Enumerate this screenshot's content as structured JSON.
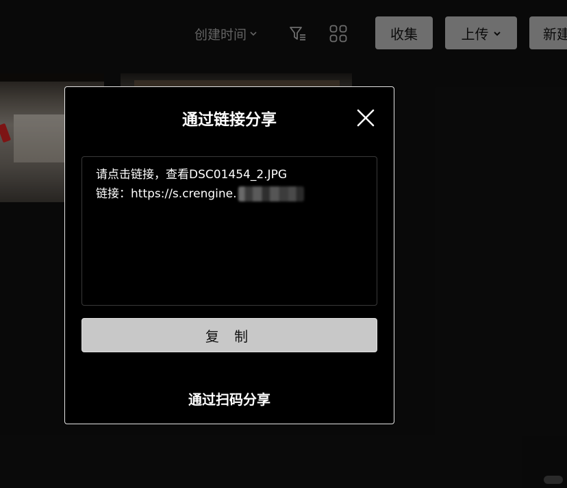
{
  "toolbar": {
    "sort_label": "创建时间",
    "sort_icon": "chevron-down-icon",
    "filter_icon": "filter-list-icon",
    "view_icon": "grid-view-icon",
    "collect_label": "收集",
    "upload_label": "上传",
    "upload_icon": "chevron-down-icon",
    "new_label": "新建"
  },
  "share_dialog": {
    "title": "通过链接分享",
    "close_icon": "close-icon",
    "message_line1": "请点击链接，查看DSC01454_2.JPG",
    "message_line2": "链接：https://s.crengine.",
    "copy_label": "复 制",
    "qr_share_label": "通过扫码分享"
  },
  "colors": {
    "page_background": "#0f0f0f",
    "modal_background": "#000000",
    "modal_border": "#e6e6e6",
    "button_gray": "#a9a9a9",
    "copy_button": "#c8c8c8",
    "muted_text": "#9a9a9a"
  }
}
